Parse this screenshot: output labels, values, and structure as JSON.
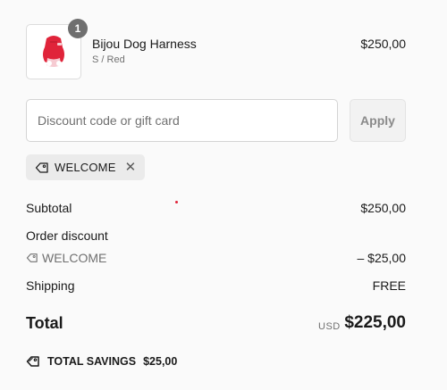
{
  "line_item": {
    "name": "Bijou Dog Harness",
    "variant": "S / Red",
    "price": "$250,00",
    "quantity": "1",
    "image_icon": "dog-harness-product-image"
  },
  "discount": {
    "placeholder": "Discount code or gift card",
    "value": "",
    "apply_label": "Apply",
    "applied_code": "WELCOME"
  },
  "summary": {
    "subtotal_label": "Subtotal",
    "subtotal_value": "$250,00",
    "order_discount_label": "Order discount",
    "discount_code": "WELCOME",
    "discount_value": "– $25,00",
    "shipping_label": "Shipping",
    "shipping_value": "FREE",
    "total_label": "Total",
    "currency": "USD",
    "total_value": "$225,00",
    "savings_label": "TOTAL SAVINGS",
    "savings_value": "$25,00"
  },
  "colors": {
    "background": "#fafafa",
    "badge": "#6f6f6f",
    "product_red": "#e0243a",
    "tag_bg": "#ebebeb"
  }
}
